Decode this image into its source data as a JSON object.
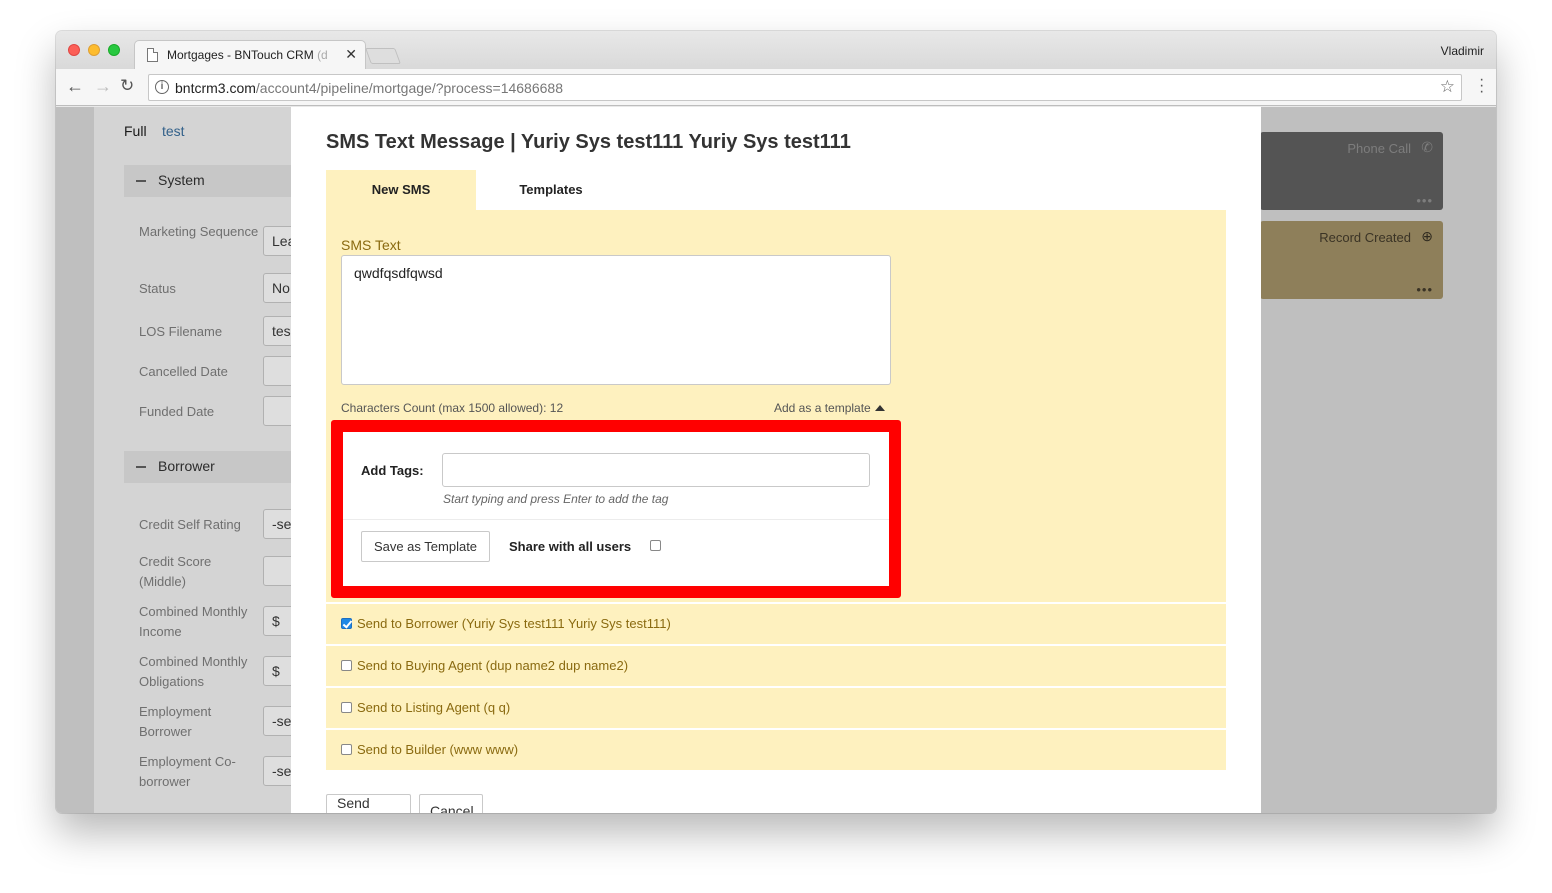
{
  "browser": {
    "tab_title": "Mortgages - BNTouch CRM",
    "tab_title_faded": "(d",
    "user": "Vladimir",
    "url_host": "bntcrm3.com",
    "url_path": "/account4/pipeline/mortgage/?process=14686688"
  },
  "background": {
    "name_label": "Full",
    "name_value": "test",
    "sections": [
      "System",
      "Borrower"
    ],
    "fields": [
      {
        "label": "Marketing Sequence",
        "value": "Lea"
      },
      {
        "label": "Status",
        "value": "No"
      },
      {
        "label": "LOS Filename",
        "value": "tes"
      },
      {
        "label": "Cancelled Date",
        "value": ""
      },
      {
        "label": "Funded Date",
        "value": ""
      },
      {
        "label": "Credit Self Rating",
        "value": "-se"
      },
      {
        "label": "Credit Score (Middle)",
        "value": ""
      },
      {
        "label": "Combined Monthly Income",
        "value": "$"
      },
      {
        "label": "Combined Monthly Obligations",
        "value": "$"
      },
      {
        "label": "Employment Borrower",
        "value": "-se"
      },
      {
        "label": "Employment Co-borrower",
        "value": "-se"
      }
    ],
    "cards": [
      {
        "label": "Phone Call",
        "icon": "phone-icon",
        "dots": "•••"
      },
      {
        "label": "Record Created",
        "icon": "plus-circle-icon",
        "dots": "•••"
      }
    ]
  },
  "modal": {
    "title": "SMS Text Message | Yuriy Sys test111 Yuriy Sys test111",
    "tabs": [
      "New SMS",
      "Templates"
    ],
    "sms_label": "SMS Text",
    "sms_text": "qwdfqsdfqwsd",
    "char_count": "Characters Count (max 1500 allowed): 12",
    "add_template_label": "Add as a template",
    "template_form": {
      "tags_label": "Add Tags:",
      "tags_value": "",
      "tags_hint": "Start typing and press Enter to add the tag",
      "save_button": "Save as Template",
      "share_label": "Share with all users",
      "share_checked": false
    },
    "recipients": [
      {
        "label": "Send to Borrower (Yuriy Sys test111 Yuriy Sys test111)",
        "checked": true
      },
      {
        "label": "Send to Buying Agent (dup name2 dup name2)",
        "checked": false
      },
      {
        "label": "Send to Listing Agent (q q)",
        "checked": false
      },
      {
        "label": "Send to Builder (www www)",
        "checked": false
      }
    ],
    "send_button": "Send SMS",
    "cancel_button": "Cancel"
  },
  "colors": {
    "panel_bg": "#fef1bf",
    "highlight_border": "#ff0000",
    "label_text": "#8a6a10",
    "checkbox_checked": "#1e88e5"
  }
}
